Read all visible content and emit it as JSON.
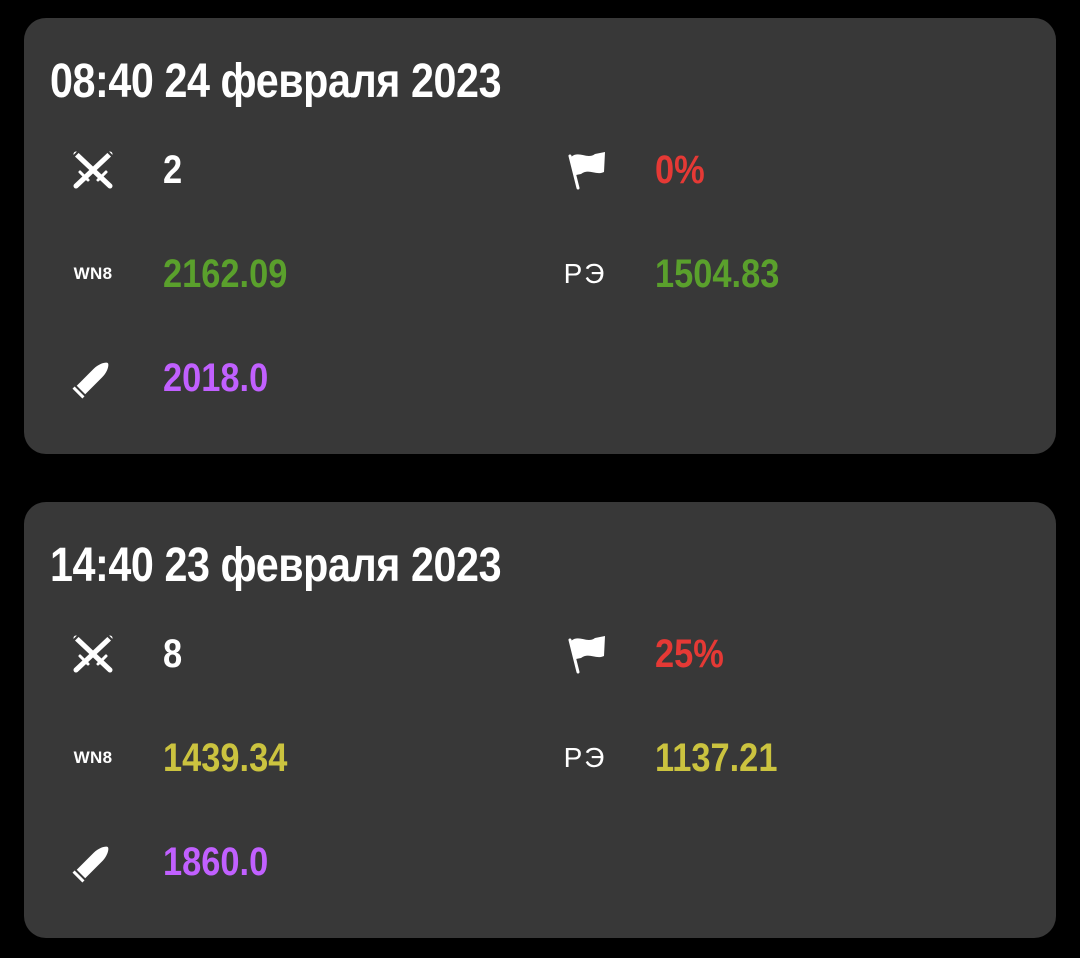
{
  "cards": [
    {
      "title": "08:40 24 февраля 2023",
      "battles": "2",
      "winrate": "0%",
      "wn8_label": "WN8",
      "wn8": "2162.09",
      "re_label": "РЭ",
      "re": "1504.83",
      "avg_damage": "2018.0",
      "colors": {
        "battles": "#ffffff",
        "winrate": "#e53935",
        "wn8": "#5aa02c",
        "re": "#5aa02c",
        "avg_damage": "#c160ff"
      }
    },
    {
      "title": "14:40 23 февраля 2023",
      "battles": "8",
      "winrate": "25%",
      "wn8_label": "WN8",
      "wn8": "1439.34",
      "re_label": "РЭ",
      "re": "1137.21",
      "avg_damage": "1860.0",
      "colors": {
        "battles": "#ffffff",
        "winrate": "#e53935",
        "wn8": "#cbc33f",
        "re": "#cbc33f",
        "avg_damage": "#c160ff"
      }
    }
  ],
  "icons": {
    "battles": "crossed-swords-icon",
    "winrate": "flag-icon",
    "avg_damage": "shell-icon"
  }
}
